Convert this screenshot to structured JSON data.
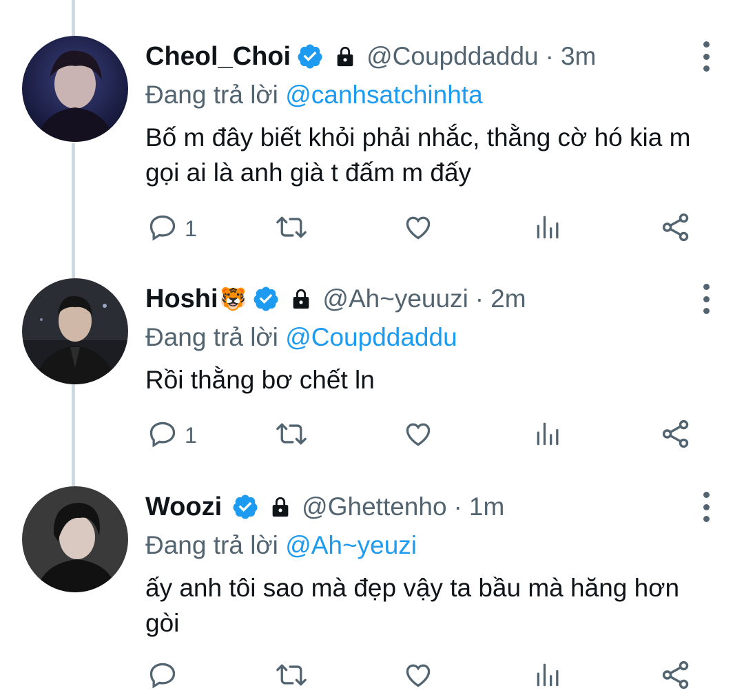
{
  "tweets": [
    {
      "name": "Cheol_Choi",
      "emoji": "",
      "handle": "@Coupddaddu",
      "separator": "·",
      "time": "3m",
      "replying_prefix": "Đang trả lời",
      "replying_to": "@canhsatchinhta",
      "text": "Bố m đây biết khỏi phải nhắc, thằng cờ hó kia m gọi ai là anh già t đấm m đấy",
      "reply_count": "1"
    },
    {
      "name": "Hoshi",
      "emoji": "🐯",
      "handle": "@Ah~yeuuzi",
      "separator": "·",
      "time": "2m",
      "replying_prefix": "Đang trả lời",
      "replying_to": "@Coupddaddu",
      "text": "Rồi thằng bơ chết ln",
      "reply_count": "1"
    },
    {
      "name": "Woozi",
      "emoji": "",
      "handle": "@Ghettenho",
      "separator": "·",
      "time": "1m",
      "replying_prefix": "Đang trả lời",
      "replying_to": "@Ah~yeuzi",
      "text": "ấy anh tôi sao mà đẹp vậy ta bầu mà hăng hơn gòi",
      "reply_count": ""
    }
  ],
  "icons": {
    "verified": "verified-badge-icon",
    "lock": "lock-icon",
    "more": "more-vertical-icon",
    "reply": "reply-icon",
    "retweet": "retweet-icon",
    "like": "like-icon",
    "analytics": "analytics-icon",
    "share": "share-icon"
  },
  "colors": {
    "accent": "#1d9bf0",
    "secondary_text": "#536471",
    "primary_text": "#0f1419",
    "thread_line": "#cfd9de"
  }
}
